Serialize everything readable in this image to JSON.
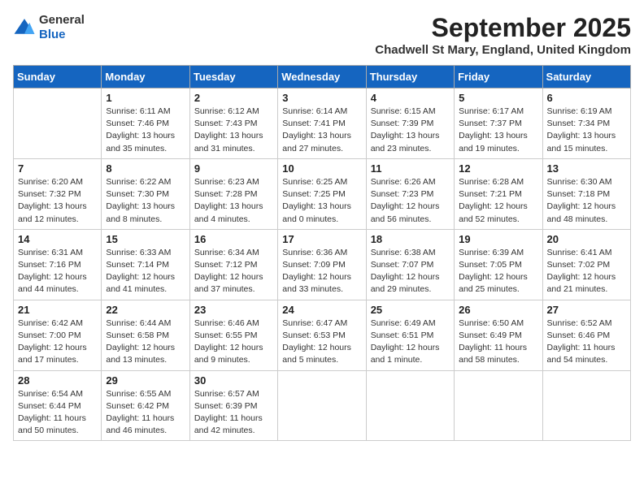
{
  "header": {
    "logo_line1": "General",
    "logo_line2": "Blue",
    "month": "September 2025",
    "location": "Chadwell St Mary, England, United Kingdom"
  },
  "weekdays": [
    "Sunday",
    "Monday",
    "Tuesday",
    "Wednesday",
    "Thursday",
    "Friday",
    "Saturday"
  ],
  "weeks": [
    [
      {
        "day": "",
        "info": ""
      },
      {
        "day": "1",
        "info": "Sunrise: 6:11 AM\nSunset: 7:46 PM\nDaylight: 13 hours\nand 35 minutes."
      },
      {
        "day": "2",
        "info": "Sunrise: 6:12 AM\nSunset: 7:43 PM\nDaylight: 13 hours\nand 31 minutes."
      },
      {
        "day": "3",
        "info": "Sunrise: 6:14 AM\nSunset: 7:41 PM\nDaylight: 13 hours\nand 27 minutes."
      },
      {
        "day": "4",
        "info": "Sunrise: 6:15 AM\nSunset: 7:39 PM\nDaylight: 13 hours\nand 23 minutes."
      },
      {
        "day": "5",
        "info": "Sunrise: 6:17 AM\nSunset: 7:37 PM\nDaylight: 13 hours\nand 19 minutes."
      },
      {
        "day": "6",
        "info": "Sunrise: 6:19 AM\nSunset: 7:34 PM\nDaylight: 13 hours\nand 15 minutes."
      }
    ],
    [
      {
        "day": "7",
        "info": "Sunrise: 6:20 AM\nSunset: 7:32 PM\nDaylight: 13 hours\nand 12 minutes."
      },
      {
        "day": "8",
        "info": "Sunrise: 6:22 AM\nSunset: 7:30 PM\nDaylight: 13 hours\nand 8 minutes."
      },
      {
        "day": "9",
        "info": "Sunrise: 6:23 AM\nSunset: 7:28 PM\nDaylight: 13 hours\nand 4 minutes."
      },
      {
        "day": "10",
        "info": "Sunrise: 6:25 AM\nSunset: 7:25 PM\nDaylight: 13 hours\nand 0 minutes."
      },
      {
        "day": "11",
        "info": "Sunrise: 6:26 AM\nSunset: 7:23 PM\nDaylight: 12 hours\nand 56 minutes."
      },
      {
        "day": "12",
        "info": "Sunrise: 6:28 AM\nSunset: 7:21 PM\nDaylight: 12 hours\nand 52 minutes."
      },
      {
        "day": "13",
        "info": "Sunrise: 6:30 AM\nSunset: 7:18 PM\nDaylight: 12 hours\nand 48 minutes."
      }
    ],
    [
      {
        "day": "14",
        "info": "Sunrise: 6:31 AM\nSunset: 7:16 PM\nDaylight: 12 hours\nand 44 minutes."
      },
      {
        "day": "15",
        "info": "Sunrise: 6:33 AM\nSunset: 7:14 PM\nDaylight: 12 hours\nand 41 minutes."
      },
      {
        "day": "16",
        "info": "Sunrise: 6:34 AM\nSunset: 7:12 PM\nDaylight: 12 hours\nand 37 minutes."
      },
      {
        "day": "17",
        "info": "Sunrise: 6:36 AM\nSunset: 7:09 PM\nDaylight: 12 hours\nand 33 minutes."
      },
      {
        "day": "18",
        "info": "Sunrise: 6:38 AM\nSunset: 7:07 PM\nDaylight: 12 hours\nand 29 minutes."
      },
      {
        "day": "19",
        "info": "Sunrise: 6:39 AM\nSunset: 7:05 PM\nDaylight: 12 hours\nand 25 minutes."
      },
      {
        "day": "20",
        "info": "Sunrise: 6:41 AM\nSunset: 7:02 PM\nDaylight: 12 hours\nand 21 minutes."
      }
    ],
    [
      {
        "day": "21",
        "info": "Sunrise: 6:42 AM\nSunset: 7:00 PM\nDaylight: 12 hours\nand 17 minutes."
      },
      {
        "day": "22",
        "info": "Sunrise: 6:44 AM\nSunset: 6:58 PM\nDaylight: 12 hours\nand 13 minutes."
      },
      {
        "day": "23",
        "info": "Sunrise: 6:46 AM\nSunset: 6:55 PM\nDaylight: 12 hours\nand 9 minutes."
      },
      {
        "day": "24",
        "info": "Sunrise: 6:47 AM\nSunset: 6:53 PM\nDaylight: 12 hours\nand 5 minutes."
      },
      {
        "day": "25",
        "info": "Sunrise: 6:49 AM\nSunset: 6:51 PM\nDaylight: 12 hours\nand 1 minute."
      },
      {
        "day": "26",
        "info": "Sunrise: 6:50 AM\nSunset: 6:49 PM\nDaylight: 11 hours\nand 58 minutes."
      },
      {
        "day": "27",
        "info": "Sunrise: 6:52 AM\nSunset: 6:46 PM\nDaylight: 11 hours\nand 54 minutes."
      }
    ],
    [
      {
        "day": "28",
        "info": "Sunrise: 6:54 AM\nSunset: 6:44 PM\nDaylight: 11 hours\nand 50 minutes."
      },
      {
        "day": "29",
        "info": "Sunrise: 6:55 AM\nSunset: 6:42 PM\nDaylight: 11 hours\nand 46 minutes."
      },
      {
        "day": "30",
        "info": "Sunrise: 6:57 AM\nSunset: 6:39 PM\nDaylight: 11 hours\nand 42 minutes."
      },
      {
        "day": "",
        "info": ""
      },
      {
        "day": "",
        "info": ""
      },
      {
        "day": "",
        "info": ""
      },
      {
        "day": "",
        "info": ""
      }
    ]
  ]
}
